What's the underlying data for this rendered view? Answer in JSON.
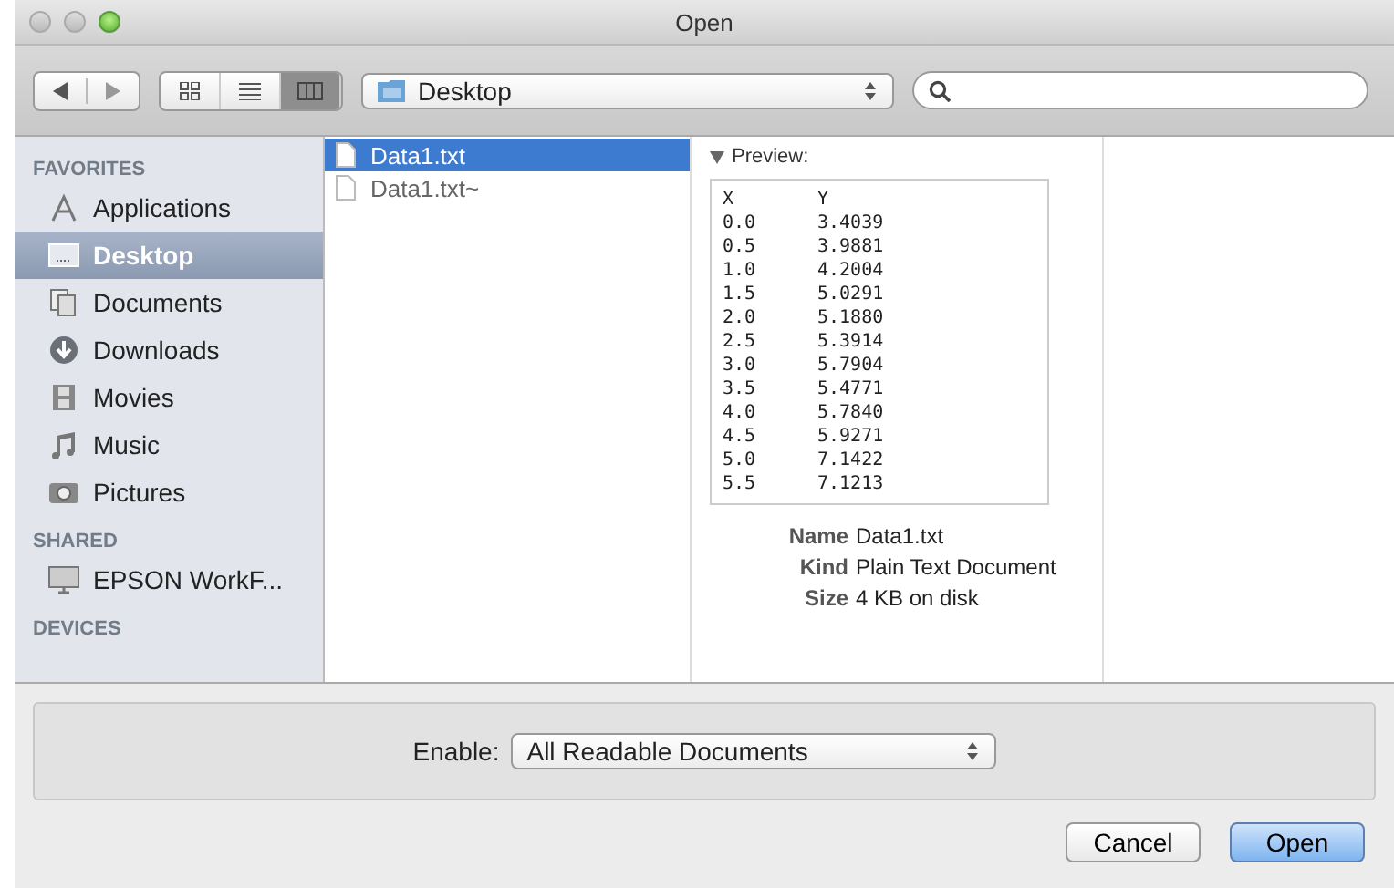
{
  "window": {
    "title": "Open"
  },
  "toolbar": {
    "view_modes": [
      {
        "kind": "icons",
        "selected": false
      },
      {
        "kind": "list",
        "selected": false
      },
      {
        "kind": "columns",
        "selected": true
      }
    ],
    "location": "Desktop"
  },
  "sidebar": {
    "sections": [
      {
        "heading": "FAVORITES",
        "items": [
          {
            "label": "Applications",
            "kind": "applications",
            "selected": false
          },
          {
            "label": "Desktop",
            "kind": "desktop",
            "selected": true
          },
          {
            "label": "Documents",
            "kind": "documents",
            "selected": false
          },
          {
            "label": "Downloads",
            "kind": "downloads",
            "selected": false
          },
          {
            "label": "Movies",
            "kind": "movies",
            "selected": false
          },
          {
            "label": "Music",
            "kind": "music",
            "selected": false
          },
          {
            "label": "Pictures",
            "kind": "pictures",
            "selected": false
          }
        ]
      },
      {
        "heading": "SHARED",
        "items": [
          {
            "label": "EPSON WorkF...",
            "kind": "computer",
            "selected": false
          }
        ]
      },
      {
        "heading": "DEVICES"
      }
    ]
  },
  "files": [
    {
      "name": "Data1.txt",
      "selected": true
    },
    {
      "name": "Data1.txt~",
      "selected": false
    }
  ],
  "preview": {
    "heading": "Preview:",
    "lines": [
      [
        "X",
        "Y"
      ],
      [
        "0.0",
        "3.4039"
      ],
      [
        "0.5",
        "3.9881"
      ],
      [
        "1.0",
        "4.2004"
      ],
      [
        "1.5",
        "5.0291"
      ],
      [
        "2.0",
        "5.1880"
      ],
      [
        "2.5",
        "5.3914"
      ],
      [
        "3.0",
        "5.7904"
      ],
      [
        "3.5",
        "5.4771"
      ],
      [
        "4.0",
        "5.7840"
      ],
      [
        "4.5",
        "5.9271"
      ],
      [
        "5.0",
        "7.1422"
      ],
      [
        "5.5",
        "7.1213"
      ]
    ],
    "info": [
      {
        "label": "Name",
        "value": "Data1.txt"
      },
      {
        "label": "Kind",
        "value": "Plain Text Document"
      },
      {
        "label": "Size",
        "value": "4 KB on disk"
      }
    ]
  },
  "enable": {
    "label": "Enable:",
    "value": "All Readable Documents"
  },
  "buttons": [
    {
      "label": "Cancel",
      "kind": "cancel"
    },
    {
      "label": "Open",
      "kind": "default"
    }
  ]
}
